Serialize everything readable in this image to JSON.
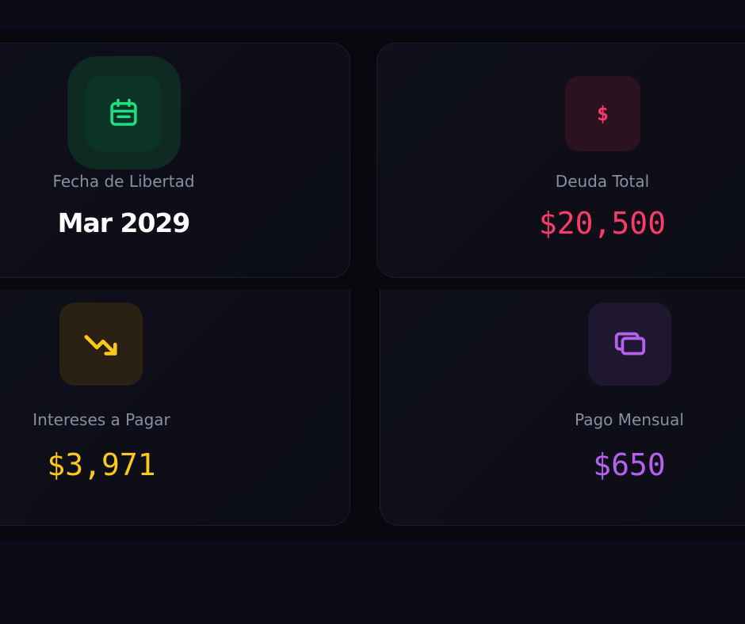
{
  "colors": {
    "green": "#19e37e",
    "red": "#ff3b6b",
    "yellow": "#ffc81a",
    "purple": "#b561f0",
    "label": "#8b8ea3"
  },
  "cards": {
    "freedom": {
      "label": "Fecha de Libertad",
      "value": "Mar 2029",
      "icon": "calendar-icon"
    },
    "debt": {
      "label": "Deuda Total",
      "value": "$20,500",
      "icon": "dollar-icon",
      "icon_glyph": "$"
    },
    "interest": {
      "label": "Intereses a Pagar",
      "value": "$3,971",
      "icon": "trending-down-icon"
    },
    "payment": {
      "label": "Pago Mensual",
      "value": "$650",
      "icon": "cards-icon"
    }
  }
}
